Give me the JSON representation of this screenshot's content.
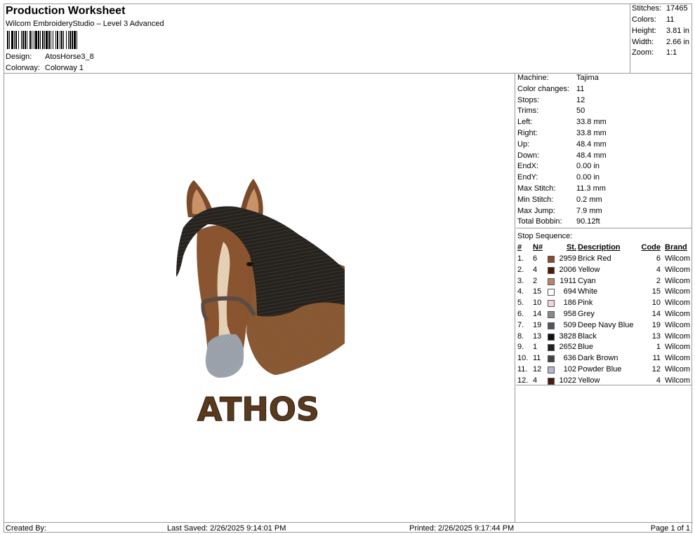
{
  "header": {
    "title": "Production Worksheet",
    "subtitle": "Wilcom EmbroideryStudio – Level 3 Advanced",
    "design_label": "Design:",
    "design_value": "AtosHorse3_8",
    "colorway_label": "Colorway:",
    "colorway_value": "Colorway 1"
  },
  "summary": [
    {
      "label": "Stitches:",
      "value": "17465"
    },
    {
      "label": "Colors:",
      "value": "11"
    },
    {
      "label": "Height:",
      "value": "3.81 in"
    },
    {
      "label": "Width:",
      "value": "2.66 in"
    },
    {
      "label": "Zoom:",
      "value": "1:1"
    }
  ],
  "machine_info": [
    {
      "label": "Machine:",
      "value": "Tajima"
    },
    {
      "label": "Color changes:",
      "value": "11"
    },
    {
      "label": "Stops:",
      "value": "12"
    },
    {
      "label": "Trims:",
      "value": "50"
    },
    {
      "label": "Left:",
      "value": "33.8 mm"
    },
    {
      "label": "Right:",
      "value": "33.8 mm"
    },
    {
      "label": "Up:",
      "value": "48.4 mm"
    },
    {
      "label": "Down:",
      "value": "48.4 mm"
    },
    {
      "label": "EndX:",
      "value": "0.00 in"
    },
    {
      "label": "EndY:",
      "value": "0.00 in"
    },
    {
      "label": "Max Stitch:",
      "value": "11.3 mm"
    },
    {
      "label": "Min Stitch:",
      "value": "0.2 mm"
    },
    {
      "label": "Max Jump:",
      "value": "7.9 mm"
    },
    {
      "label": "Total Bobbin:",
      "value": "90.12ft"
    }
  ],
  "stop_sequence": {
    "heading": "Stop Sequence:",
    "columns": {
      "idx": "#",
      "n": "N#",
      "st": "St.",
      "desc": "Description",
      "code": "Code",
      "brand": "Brand"
    },
    "rows": [
      {
        "idx": "1.",
        "n": "6",
        "color": "#8e4a2e",
        "st": "2959",
        "desc": "Brick Red",
        "code": "6",
        "brand": "Wilcom"
      },
      {
        "idx": "2.",
        "n": "4",
        "color": "#4a1a0a",
        "st": "2006",
        "desc": "Yellow",
        "code": "4",
        "brand": "Wilcom"
      },
      {
        "idx": "3.",
        "n": "2",
        "color": "#b8866a",
        "st": "1911",
        "desc": "Cyan",
        "code": "2",
        "brand": "Wilcom"
      },
      {
        "idx": "4.",
        "n": "15",
        "color": "#ffffff",
        "st": "694",
        "desc": "White",
        "code": "15",
        "brand": "Wilcom"
      },
      {
        "idx": "5.",
        "n": "10",
        "color": "#f4d4d8",
        "st": "186",
        "desc": "Pink",
        "code": "10",
        "brand": "Wilcom"
      },
      {
        "idx": "6.",
        "n": "14",
        "color": "#8a8a8a",
        "st": "958",
        "desc": "Grey",
        "code": "14",
        "brand": "Wilcom"
      },
      {
        "idx": "7.",
        "n": "19",
        "color": "#555560",
        "st": "509",
        "desc": "Deep Navy Blue",
        "code": "19",
        "brand": "Wilcom"
      },
      {
        "idx": "8.",
        "n": "13",
        "color": "#111111",
        "st": "3828",
        "desc": "Black",
        "code": "13",
        "brand": "Wilcom"
      },
      {
        "idx": "9.",
        "n": "1",
        "color": "#222222",
        "st": "2652",
        "desc": "Blue",
        "code": "1",
        "brand": "Wilcom"
      },
      {
        "idx": "10.",
        "n": "11",
        "color": "#444444",
        "st": "636",
        "desc": "Dark Brown",
        "code": "11",
        "brand": "Wilcom"
      },
      {
        "idx": "11.",
        "n": "12",
        "color": "#b9b4d6",
        "st": "102",
        "desc": "Powder Blue",
        "code": "12",
        "brand": "Wilcom"
      },
      {
        "idx": "12.",
        "n": "4",
        "color": "#4a1a0a",
        "st": "1022",
        "desc": "Yellow",
        "code": "4",
        "brand": "Wilcom"
      }
    ]
  },
  "design_text": "ATHOS",
  "footer": {
    "created_by": "Created By:",
    "last_saved": "Last Saved: 2/26/2025 9:14:01 PM",
    "printed": "Printed: 2/26/2025 9:17:44 PM",
    "page": "Page 1 of 1"
  }
}
